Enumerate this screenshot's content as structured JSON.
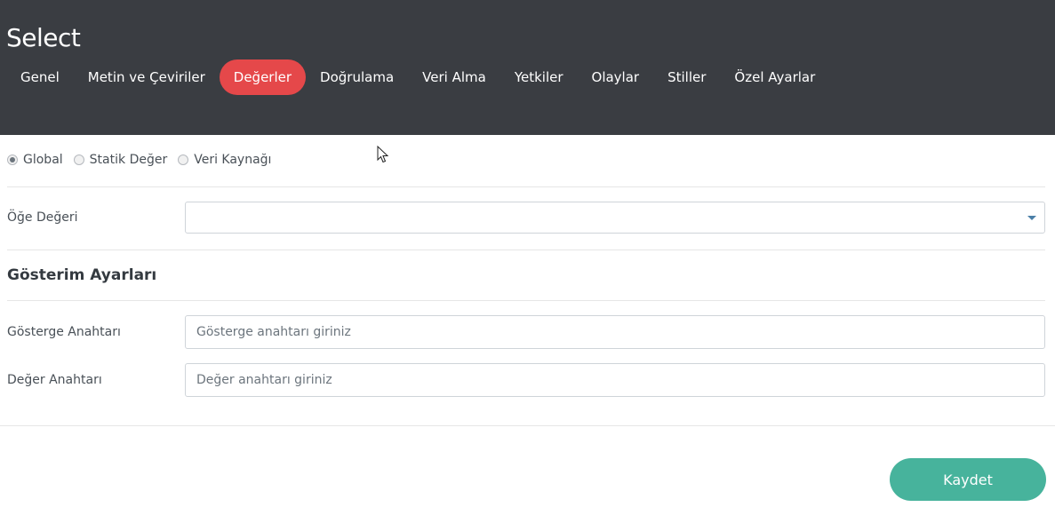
{
  "header": {
    "title": "Select",
    "tabs": [
      {
        "label": "Genel",
        "active": false
      },
      {
        "label": "Metin ve Çeviriler",
        "active": false
      },
      {
        "label": "Değerler",
        "active": true
      },
      {
        "label": "Doğrulama",
        "active": false
      },
      {
        "label": "Veri Alma",
        "active": false
      },
      {
        "label": "Yetkiler",
        "active": false
      },
      {
        "label": "Olaylar",
        "active": false
      },
      {
        "label": "Stiller",
        "active": false
      },
      {
        "label": "Özel Ayarlar",
        "active": false
      }
    ]
  },
  "source": {
    "options": [
      {
        "label": "Global",
        "checked": true
      },
      {
        "label": "Statik Değer",
        "checked": false
      },
      {
        "label": "Veri Kaynağı",
        "checked": false
      }
    ]
  },
  "item_value": {
    "label": "Öğe Değeri",
    "value": ""
  },
  "display_settings": {
    "title": "Gösterim Ayarları",
    "display_key": {
      "label": "Gösterge Anahtarı",
      "value": "",
      "placeholder": "Gösterge anahtarı giriniz"
    },
    "value_key": {
      "label": "Değer Anahtarı",
      "value": "",
      "placeholder": "Değer anahtarı giriniz"
    }
  },
  "actions": {
    "save_label": "Kaydet"
  },
  "colors": {
    "header_bg": "#3a3d42",
    "active_tab": "#e5484a",
    "save_button": "#47b39c"
  }
}
